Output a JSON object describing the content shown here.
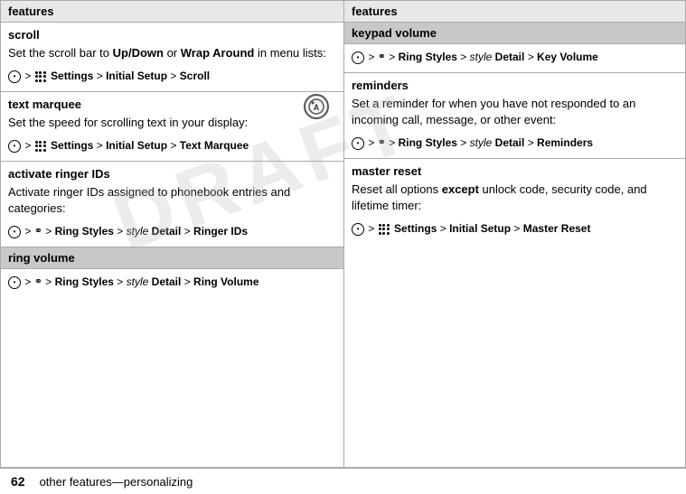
{
  "page": {
    "footer": {
      "page_number": "62",
      "description": "other features—personalizing"
    },
    "draft_watermark": "DRAFT"
  },
  "left": {
    "header": "features",
    "sections": [
      {
        "id": "scroll",
        "header": "scroll",
        "body": "Set the scroll bar to Up/Down or Wrap Around in menu lists:",
        "nav": "• > Settings > Initial Setup > Scroll",
        "has_subheader": false
      },
      {
        "id": "text-marquee",
        "header": "text marquee",
        "body": "Set the speed for scrolling text in your display:",
        "nav": "• > Settings > Initial Setup > Text Marquee",
        "has_subheader": false
      },
      {
        "id": "activate-ringer-ids",
        "header": "activate ringer IDs",
        "body": "Activate ringer IDs assigned to phonebook entries and categories:",
        "nav": "• > Ring Styles > style Detail > Ringer IDs",
        "has_subheader": false
      },
      {
        "id": "ring-volume",
        "header": "ring volume",
        "nav": "• > Ring Styles > style Detail > Ring Volume",
        "has_subheader": false
      }
    ]
  },
  "right": {
    "header": "features",
    "sections": [
      {
        "id": "keypad-volume",
        "header": "keypad volume",
        "nav": "• > Ring Styles > style Detail > Key Volume",
        "has_body": false
      },
      {
        "id": "reminders",
        "header": "reminders",
        "body": "Set a reminder for when you have not responded to an incoming call, message, or other event:",
        "nav": "• > Ring Styles > style Detail > Reminders"
      },
      {
        "id": "master-reset",
        "header": "master reset",
        "body_pre": "Reset all options ",
        "body_bold": "except",
        "body_post": " unlock code, security code, and lifetime timer:",
        "nav": "• > Settings > Initial Setup > Master Reset"
      }
    ]
  }
}
